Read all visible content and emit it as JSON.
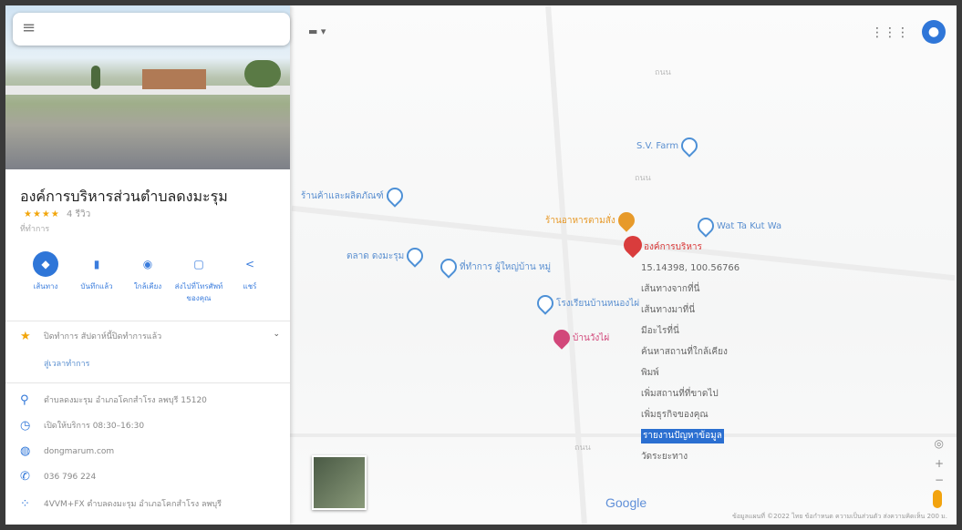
{
  "search": {
    "value": "",
    "placeholder": ""
  },
  "place": {
    "name": "องค์การบริหารส่วนตำบลดงมะรุม",
    "rating_stars": "★★★★",
    "reviews": "4 รีวิว",
    "category": "ที่ทำการ"
  },
  "actions": [
    {
      "label": "เส้นทาง",
      "icon": "◆"
    },
    {
      "label": "บันทึกแล้ว",
      "icon": "▮"
    },
    {
      "label": "ใกล้เคียง",
      "icon": "◉"
    },
    {
      "label": "ส่งไปที่โทรศัพท์ของคุณ",
      "icon": "▢"
    },
    {
      "label": "แชร์",
      "icon": "<"
    }
  ],
  "info": {
    "hours_summary": "ปิดทำการ สัปดาห์นี้ปิดทำการแล้ว",
    "suggest_edit": "สู่เวลาทำการ",
    "address": "ตำบลดงมะรุม อำเภอโคกสำโรง ลพบุรี 15120",
    "hours": "เปิดให้บริการ 08:30–16:30",
    "website": "dongmarum.com",
    "phone": "036 796 224",
    "plus_code": "4VVM+FX ตำบลดงมะรุม อำเภอโคกสำโรง ลพบุรี"
  },
  "map": {
    "mode_label": "▬ ▾",
    "pois": [
      {
        "name": "S.V. Farm",
        "style": "blue"
      },
      {
        "name": "ร้านค้าและผลิตภัณฑ์",
        "style": "blue"
      },
      {
        "name": "ร้านอาหารตามสั่ง",
        "style": "orange"
      },
      {
        "name": "Wat Ta Kut Wa",
        "style": "blue"
      },
      {
        "name": "ตลาด ดงมะรุม",
        "style": "blue"
      },
      {
        "name": "ที่ทำการ ผู้ใหญ่บ้าน หมู่",
        "style": "blue"
      },
      {
        "name": "โรงเรียนบ้านหนองไผ่",
        "style": "blue"
      },
      {
        "name": "บ้านวังไผ่",
        "style": "pink"
      }
    ],
    "place_label": "องค์การบริหาร",
    "labels": [
      "ถนน",
      "ถนน",
      "ถนน"
    ],
    "logo": "Google",
    "footer": "ข้อมูลแผนที่ ©2022   ไทย   ข้อกำหนด   ความเป็นส่วนตัว   ส่งความคิดเห็น   200 ม."
  },
  "context_menu": [
    "15.14398, 100.56766",
    "เส้นทางจากที่นี่",
    "เส้นทางมาที่นี่",
    "มีอะไรที่นี่",
    "ค้นหาสถานที่ใกล้เคียง",
    "พิมพ์",
    "เพิ่มสถานที่ที่ขาดไป",
    "เพิ่มธุรกิจของคุณ",
    "รายงานปัญหาข้อมูล",
    "วัดระยะทาง"
  ],
  "colors": {
    "accent": "#2f76d8",
    "pin_red": "#d93c3c",
    "star": "#f2a60c"
  }
}
